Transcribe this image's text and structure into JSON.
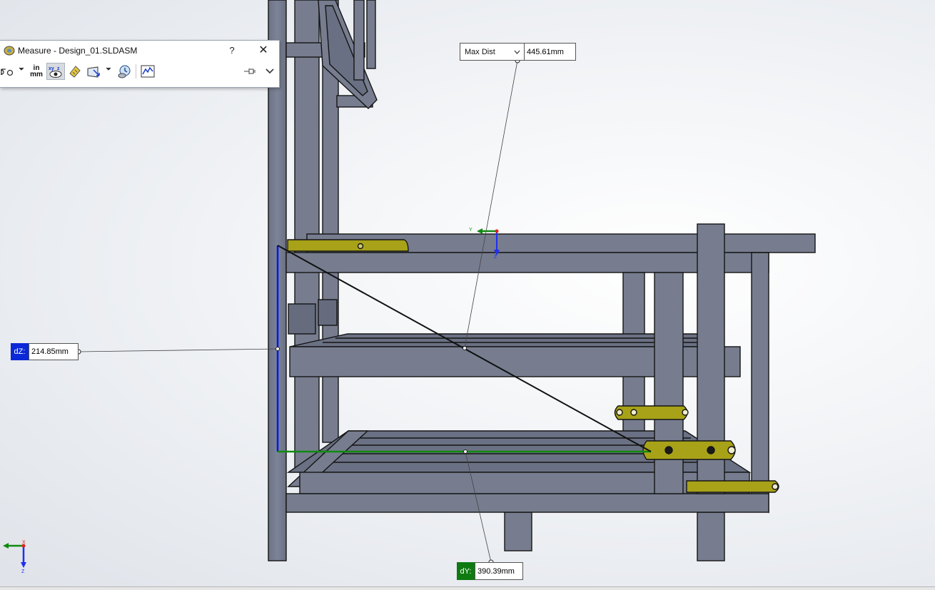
{
  "dialog": {
    "title": "Measure - Design_01.SLDASM",
    "help_label": "?",
    "close_label": "✕",
    "units_in": "in",
    "units_mm": "mm"
  },
  "measurements": {
    "max_dist": {
      "mode": "Max Dist",
      "value": "445.61mm"
    },
    "dz": {
      "tag": "dZ:",
      "value": "214.85mm"
    },
    "dy": {
      "tag": "dY:",
      "value": "390.39mm"
    }
  },
  "triad": {
    "x": "X",
    "y": "Y",
    "z": "Z"
  },
  "colors": {
    "frame": "#777d8f",
    "frame_edge": "#1a1a1a",
    "bracket": "#a8a218",
    "dz_axis": "#0018e8",
    "dy_axis": "#108a10",
    "dz_tag": "#0a28d8",
    "dy_tag": "#0e7a10"
  }
}
